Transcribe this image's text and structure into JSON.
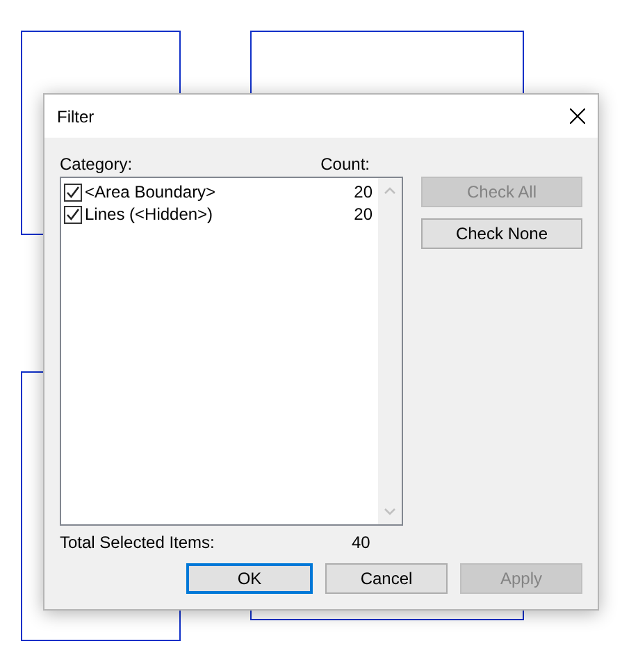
{
  "dialog": {
    "title": "Filter",
    "category_header": "Category:",
    "count_header": "Count:",
    "items": [
      {
        "label": "<Area Boundary>",
        "count": "20",
        "checked": true
      },
      {
        "label": "Lines (<Hidden>)",
        "count": "20",
        "checked": true
      }
    ],
    "side_buttons": [
      {
        "label": "Check All",
        "disabled": true
      },
      {
        "label": "Check None",
        "disabled": false
      }
    ],
    "total_label": "Total Selected Items:",
    "total_value": "40",
    "buttons": [
      {
        "label": "OK",
        "disabled": false,
        "default": true
      },
      {
        "label": "Cancel",
        "disabled": false,
        "default": false
      },
      {
        "label": "Apply",
        "disabled": true,
        "default": false
      }
    ]
  }
}
